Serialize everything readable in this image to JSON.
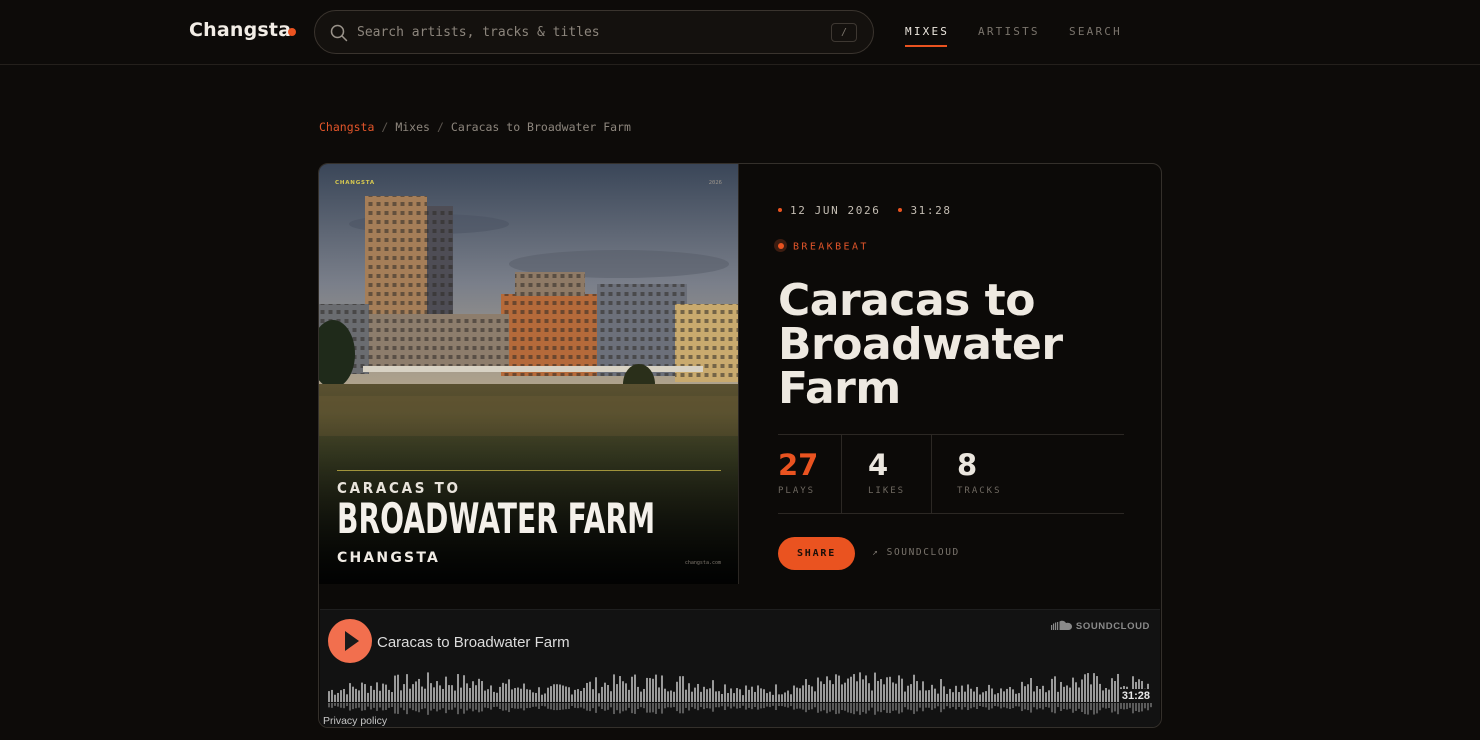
{
  "header": {
    "brand": "Changsta",
    "search_placeholder": "Search artists, tracks & titles",
    "search_shortcut": "/",
    "nav": [
      {
        "label": "MIXES",
        "active": true
      },
      {
        "label": "ARTISTS",
        "active": false
      },
      {
        "label": "SEARCH",
        "active": false
      }
    ]
  },
  "breadcrumb": [
    "Changsta",
    "Mixes",
    "Caracas to Broadwater Farm"
  ],
  "cover": {
    "tag": "CHANGSTA",
    "year": "2026",
    "line1": "CARACAS TO",
    "line2": "BROADWATER FARM",
    "artist": "CHANGSTA",
    "site": "changsta.com"
  },
  "mix": {
    "date": "12 JUN 2026",
    "duration": "31:28",
    "genre": "BREAKBEAT",
    "title": "Caracas to Broadwater Farm",
    "stats": [
      {
        "value": "27",
        "label": "PLAYS"
      },
      {
        "value": "4",
        "label": "LIKES"
      },
      {
        "value": "8",
        "label": "TRACKS"
      }
    ],
    "share_label": "SHARE",
    "soundcloud_link": "↗ SOUNDCLOUD"
  },
  "player": {
    "track_title": "Caracas to Broadwater Farm",
    "badge": "SOUNDCLOUD",
    "time": "31:28",
    "privacy": "Privacy policy"
  },
  "colors": {
    "accent": "#ea5320",
    "background": "#0d0b09",
    "play_button": "#f26f4e"
  }
}
